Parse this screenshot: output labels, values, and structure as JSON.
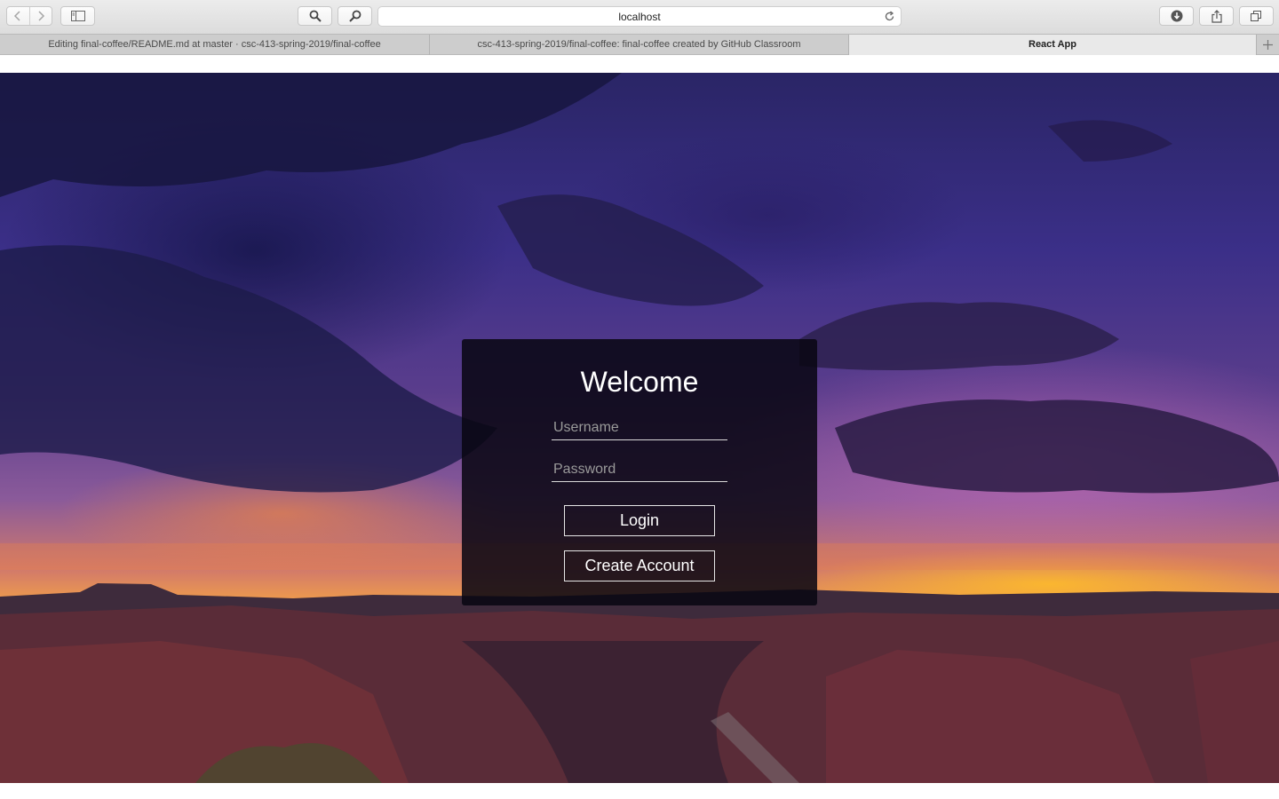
{
  "browser": {
    "address": "localhost",
    "icons": {
      "back": "chevron-left-icon",
      "forward": "chevron-right-icon",
      "sidebar": "sidebar-icon",
      "search": "search-icon",
      "reload": "reload-icon",
      "downloads": "download-icon",
      "share": "share-icon",
      "tabs": "tabs-overview-icon",
      "new_tab": "plus-icon"
    },
    "tabs": [
      {
        "label": "Editing final-coffee/README.md at master · csc-413-spring-2019/final-coffee",
        "active": false
      },
      {
        "label": "csc-413-spring-2019/final-coffee: final-coffee created by GitHub Classroom",
        "active": false
      },
      {
        "label": "React App",
        "active": true
      }
    ]
  },
  "login": {
    "title": "Welcome",
    "username_placeholder": "Username",
    "password_placeholder": "Password",
    "login_label": "Login",
    "create_label": "Create Account"
  }
}
